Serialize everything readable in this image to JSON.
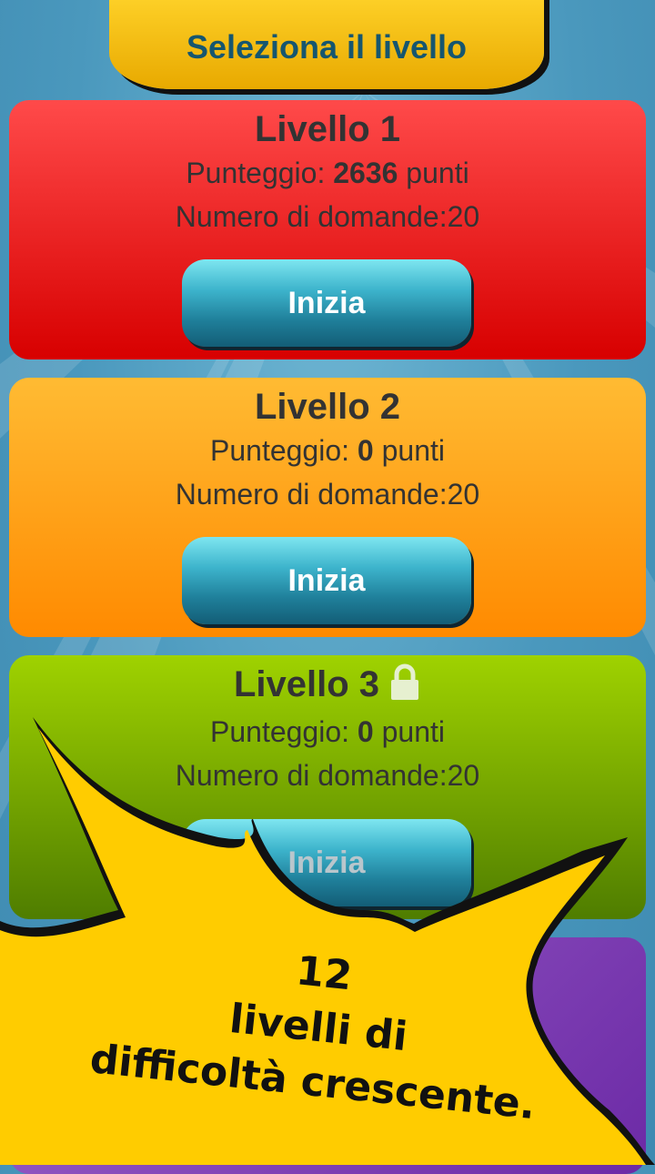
{
  "header": {
    "title": "Seleziona il livello"
  },
  "levels": [
    {
      "title": "Livello 1",
      "score_prefix": "Punteggio: ",
      "score": "2636",
      "score_suffix": " punti",
      "questions": "Numero di domande:20",
      "button": "Inizia",
      "locked": false,
      "color": "#e81e1e"
    },
    {
      "title": "Livello 2",
      "score_prefix": "Punteggio: ",
      "score": "0",
      "score_suffix": " punti",
      "questions": "Numero di domande:20",
      "button": "Inizia",
      "locked": false,
      "color": "#ffa018"
    },
    {
      "title": "Livello 3",
      "score_prefix": "Punteggio: ",
      "score": "0",
      "score_suffix": " punti",
      "questions": "Numero di domande:20",
      "button": "Inizia",
      "locked": true,
      "color": "#7aab00"
    }
  ],
  "promo": {
    "line1": "12",
    "line2": "livelli di",
    "line3": "difficoltà crescente.",
    "color": "#ffcc00"
  },
  "icons": {
    "lock": "lock-icon"
  }
}
